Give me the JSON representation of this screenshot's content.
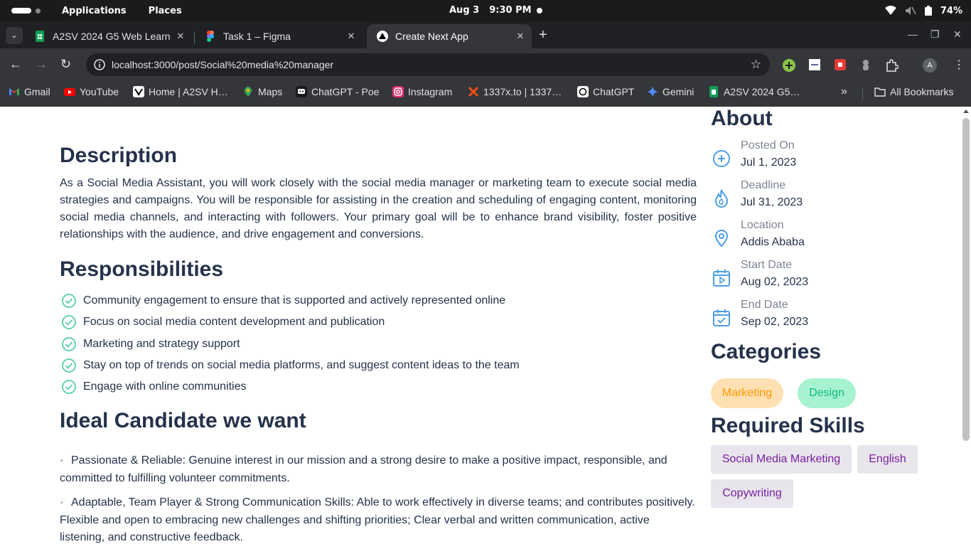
{
  "system_bar": {
    "applications": "Applications",
    "places": "Places",
    "date": "Aug 3",
    "time": "9:30 PM",
    "battery": "74%"
  },
  "tabs": [
    {
      "title": "A2SV 2024 G5 Web Learn",
      "favicon": "sheets-icon",
      "active": false
    },
    {
      "title": "Task 1 – Figma",
      "favicon": "figma-icon",
      "active": false
    },
    {
      "title": "Create Next App",
      "favicon": "nextjs-icon",
      "active": true
    }
  ],
  "omnibox": {
    "url": "localhost:3000/post/Social%20media%20manager"
  },
  "profile": {
    "initial": "A"
  },
  "bookmarks": [
    {
      "label": "Gmail",
      "icon": "gmail-icon",
      "color": "#ea4335"
    },
    {
      "label": "YouTube",
      "icon": "youtube-icon",
      "color": "#ff0000"
    },
    {
      "label": "Home | A2SV H…",
      "icon": "a2sv-icon",
      "color": "#ffffff"
    },
    {
      "label": "Maps",
      "icon": "maps-icon",
      "color": "#34a853"
    },
    {
      "label": "ChatGPT - Poe",
      "icon": "poe-icon",
      "color": "#5d5cde"
    },
    {
      "label": "Instagram",
      "icon": "instagram-icon",
      "color": "#e1306c"
    },
    {
      "label": "1337x.to | 1337…",
      "icon": "1337x-icon",
      "color": "#f14e13"
    },
    {
      "label": "ChatGPT",
      "icon": "openai-icon",
      "color": "#ffffff"
    },
    {
      "label": "Gemini",
      "icon": "gemini-icon",
      "color": "#4f8df7"
    },
    {
      "label": "A2SV 2024 G5…",
      "icon": "sheets-icon",
      "color": "#0f9d58"
    }
  ],
  "bookmarks_all": "All Bookmarks",
  "page": {
    "description": {
      "title": "Description",
      "text": "As a Social Media Assistant, you will work closely with the social media manager or marketing team to execute social media strategies and campaigns. You will be responsible for assisting in the creation and scheduling of engaging content, monitoring social media channels, and interacting with followers. Your primary goal will be to enhance brand visibility, foster positive relationships with the audience, and drive engagement and conversions."
    },
    "responsibilities": {
      "title": "Responsibilities",
      "items": [
        "Community engagement to ensure that is supported and actively represented online",
        "Focus on social media content development and publication",
        "Marketing and strategy support",
        "Stay on top of trends on social media platforms, and suggest content ideas to the team",
        "Engage with online communities"
      ]
    },
    "ideal_candidate": {
      "title": "Ideal Candidate we want",
      "items": [
        "Passionate & Reliable: Genuine interest in our mission and a strong desire to make a positive impact, responsible, and committed to fulfilling volunteer commitments.",
        "Adaptable, Team Player & Strong Communication Skills: Able to work effectively in diverse teams; and contributes positively. Flexible and open to embracing new challenges and shifting priorities; Clear verbal and written communication, active listening, and constructive feedback."
      ]
    },
    "about": {
      "title": "About",
      "items": [
        {
          "label": "Posted On",
          "value": "Jul 1, 2023",
          "icon": "plus-circle-icon"
        },
        {
          "label": "Deadline",
          "value": "Jul 31, 2023",
          "icon": "flame-icon"
        },
        {
          "label": "Location",
          "value": "Addis Ababa",
          "icon": "location-pin-icon"
        },
        {
          "label": "Start Date",
          "value": "Aug 02, 2023",
          "icon": "calendar-play-icon"
        },
        {
          "label": "End Date",
          "value": "Sep 02, 2023",
          "icon": "calendar-check-icon"
        }
      ]
    },
    "categories": {
      "title": "Categories",
      "items": [
        "Marketing",
        "Design"
      ]
    },
    "skills": {
      "title": "Required Skills",
      "items": [
        "Social Media Marketing",
        "English",
        "Copywriting"
      ]
    }
  },
  "colors": {
    "heading": "#25324b",
    "icon_blue": "#4d9ee8",
    "check_green": "#56cdad",
    "skill_text": "#7a1fa2"
  }
}
